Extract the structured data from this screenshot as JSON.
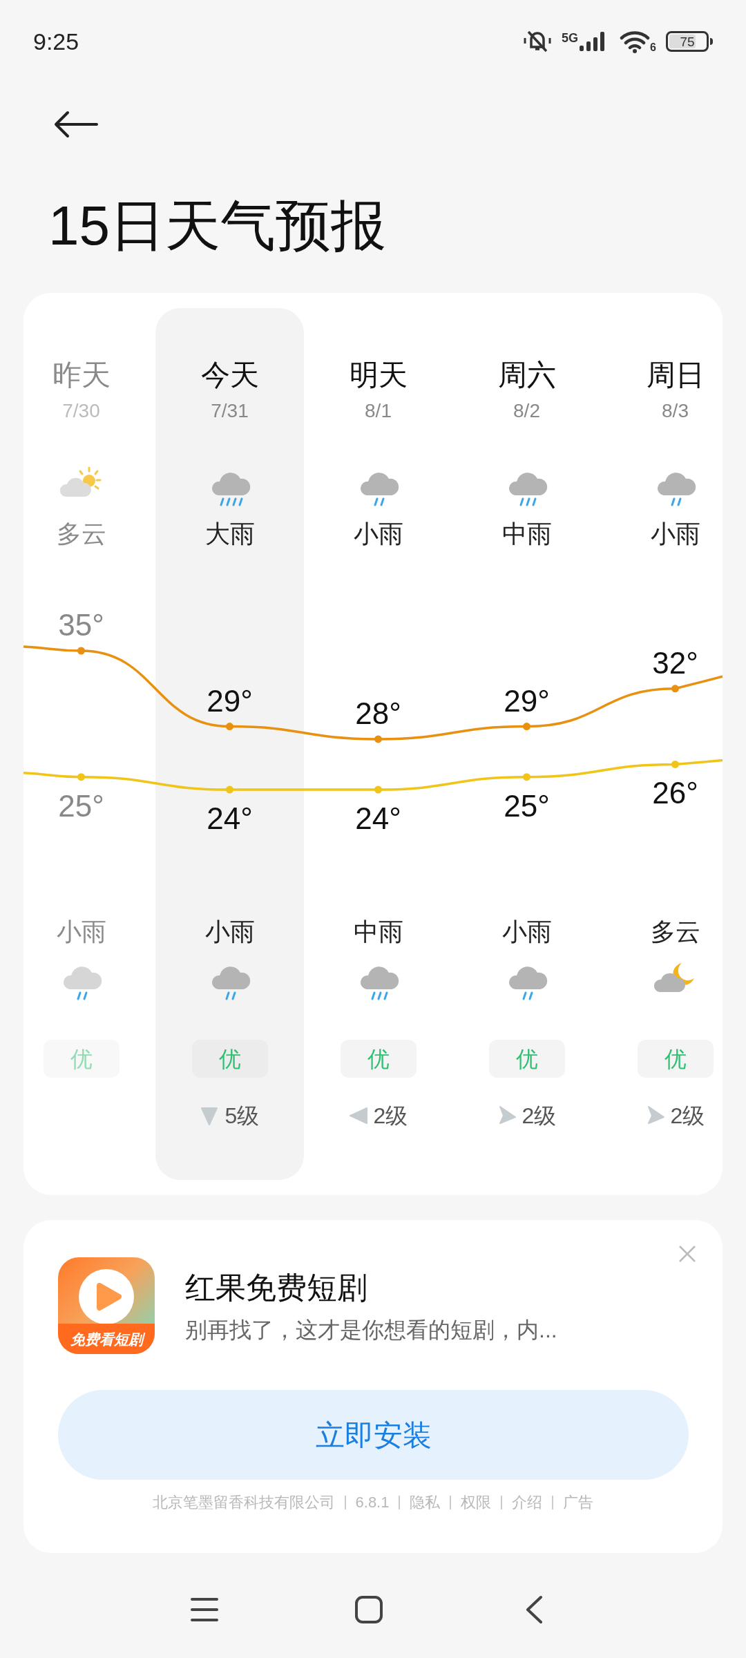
{
  "status_bar": {
    "time": "9:25",
    "network": "5G",
    "wifi_label": "6",
    "battery": "75"
  },
  "title": "15日天气预报",
  "days": [
    {
      "name": "昨天",
      "date": "7/30",
      "past": true,
      "selected": false,
      "day_icon": {
        "kind": "partly_cloudy_day"
      },
      "day_weather": "多云",
      "high": "35°",
      "low": "25°",
      "night_weather": "小雨",
      "night_icon": {
        "kind": "light_rain"
      },
      "aqi": "优"
    },
    {
      "name": "今天",
      "date": "7/31",
      "past": false,
      "selected": true,
      "day_icon": {
        "kind": "heavy_rain"
      },
      "day_weather": "大雨",
      "high": "29°",
      "low": "24°",
      "night_weather": "小雨",
      "night_icon": {
        "kind": "light_rain"
      },
      "aqi": "优",
      "wind": {
        "kind": "down",
        "text": "5级"
      }
    },
    {
      "name": "明天",
      "date": "8/1",
      "past": false,
      "selected": false,
      "day_icon": {
        "kind": "light_rain"
      },
      "day_weather": "小雨",
      "high": "28°",
      "low": "24°",
      "night_weather": "中雨",
      "night_icon": {
        "kind": "moderate_rain"
      },
      "aqi": "优",
      "wind": {
        "kind": "left",
        "text": "2级"
      }
    },
    {
      "name": "周六",
      "date": "8/2",
      "past": false,
      "selected": false,
      "day_icon": {
        "kind": "moderate_rain"
      },
      "day_weather": "中雨",
      "high": "29°",
      "low": "25°",
      "night_weather": "小雨",
      "night_icon": {
        "kind": "light_rain"
      },
      "aqi": "优",
      "wind": {
        "kind": "right",
        "text": "2级"
      }
    },
    {
      "name": "周日",
      "date": "8/3",
      "past": false,
      "selected": false,
      "day_icon": {
        "kind": "light_rain"
      },
      "day_weather": "小雨",
      "high": "32°",
      "low": "26°",
      "night_weather": "多云",
      "night_icon": {
        "kind": "partly_cloudy_night"
      },
      "aqi": "优",
      "wind": {
        "kind": "right",
        "text": "2级"
      }
    }
  ],
  "ad": {
    "app_icon_label": "免费看短剧",
    "title": "红果免费短剧",
    "description": "别再找了，这才是你想看的短剧，内...",
    "button": "立即安装",
    "footer": [
      "北京笔墨留香科技有限公司",
      "6.8.1",
      "隐私",
      "权限",
      "介绍",
      "广告"
    ]
  }
}
